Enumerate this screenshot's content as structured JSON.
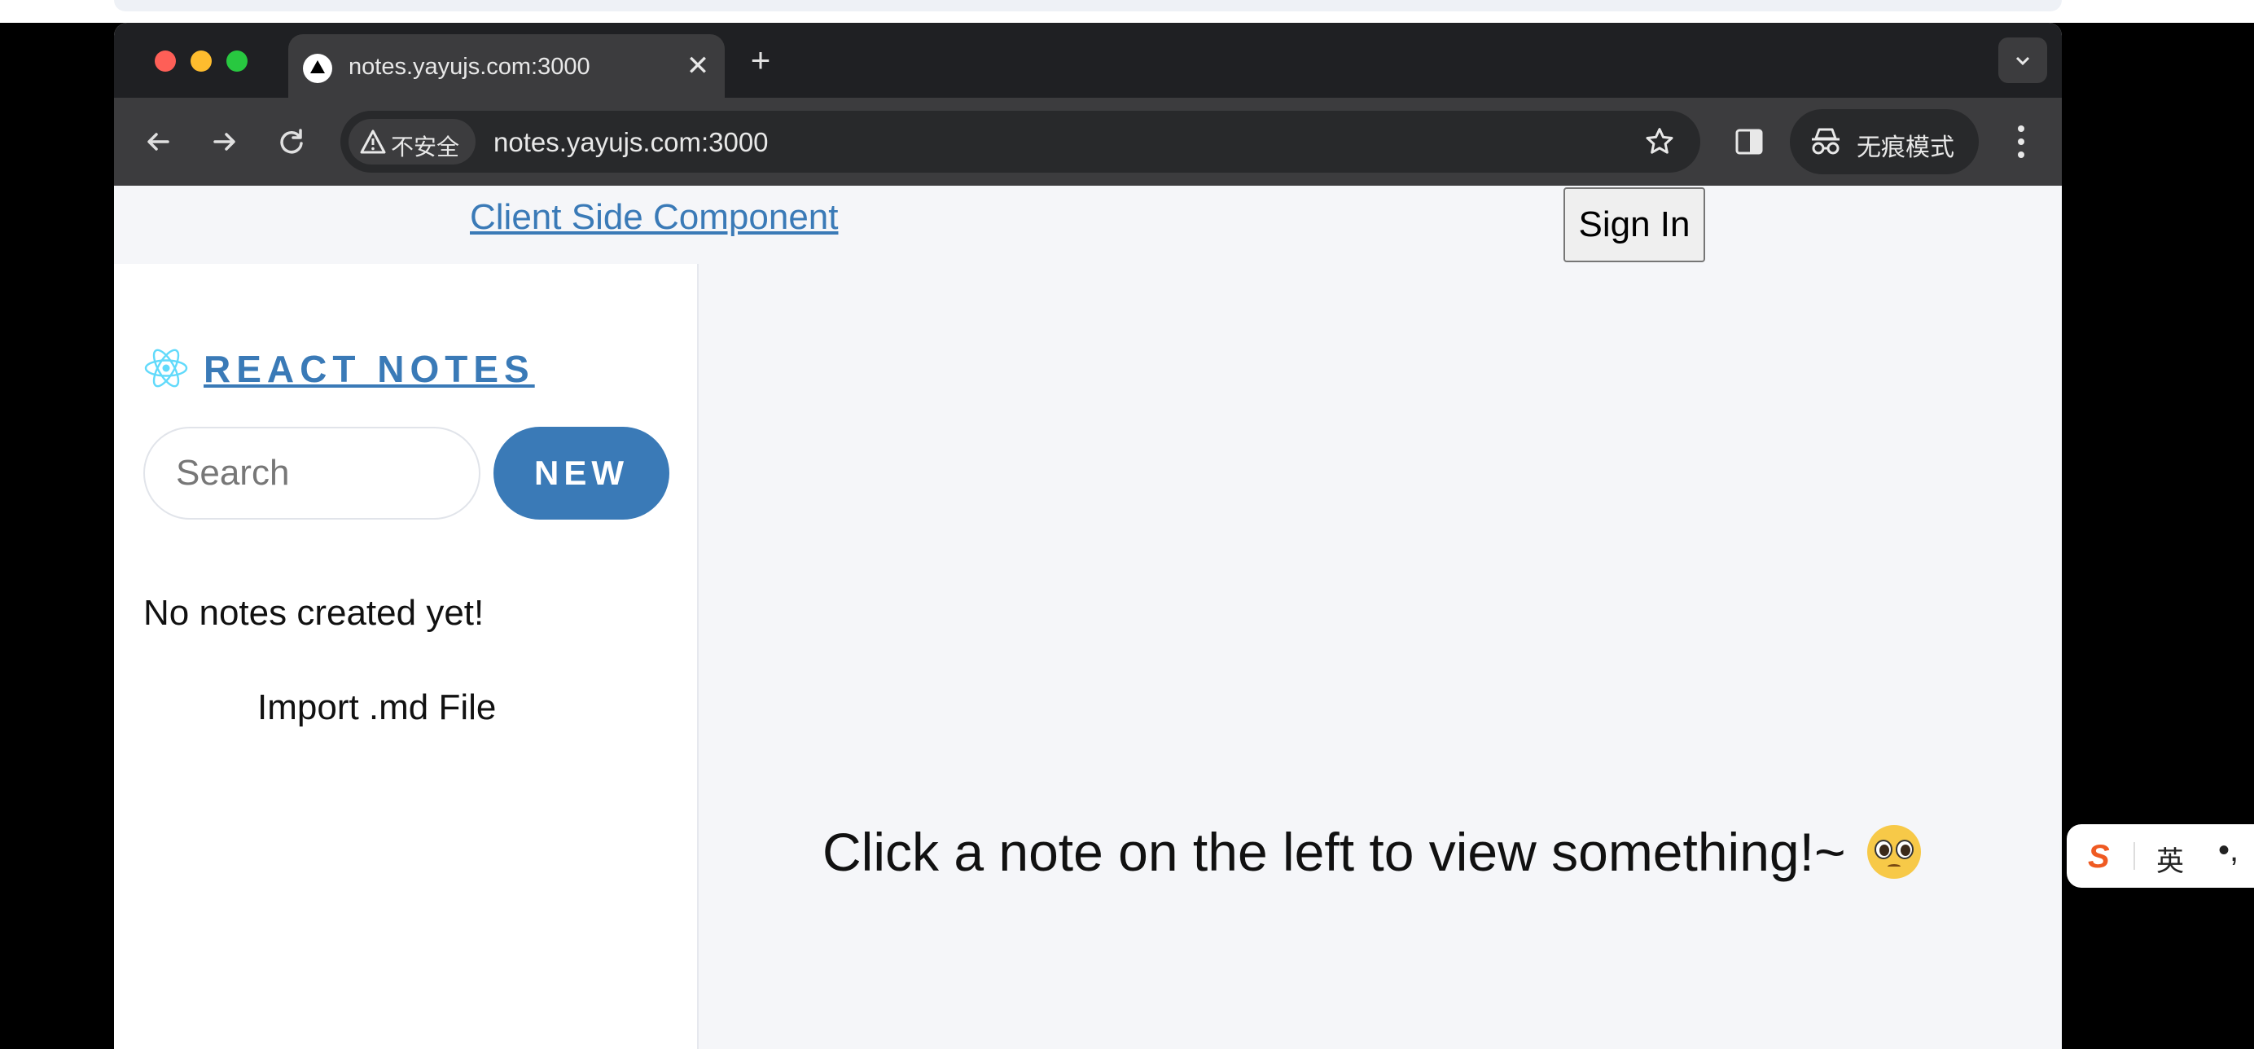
{
  "browser": {
    "tab": {
      "title": "notes.yayujs.com:3000",
      "close": "✕"
    },
    "new_tab": "+",
    "security_label": "不安全",
    "url": "notes.yayujs.com:3000",
    "incognito_label": "无痕模式"
  },
  "page": {
    "top_link": "Client Side Component",
    "sign_in": "Sign In",
    "sidebar": {
      "brand": "REACT NOTES",
      "search_placeholder": "Search",
      "new_button": "NEW",
      "empty_text": "No notes created yet!",
      "import_label": "Import .md File"
    },
    "main": {
      "empty_message": "Click a note on the left to view something!~"
    }
  },
  "ime": {
    "logo": "S",
    "language": "英",
    "punct": "•,"
  },
  "colors": {
    "accent": "#3a7ab7",
    "chrome_dark": "#1f2023",
    "toolbar": "#3c3c3e"
  }
}
